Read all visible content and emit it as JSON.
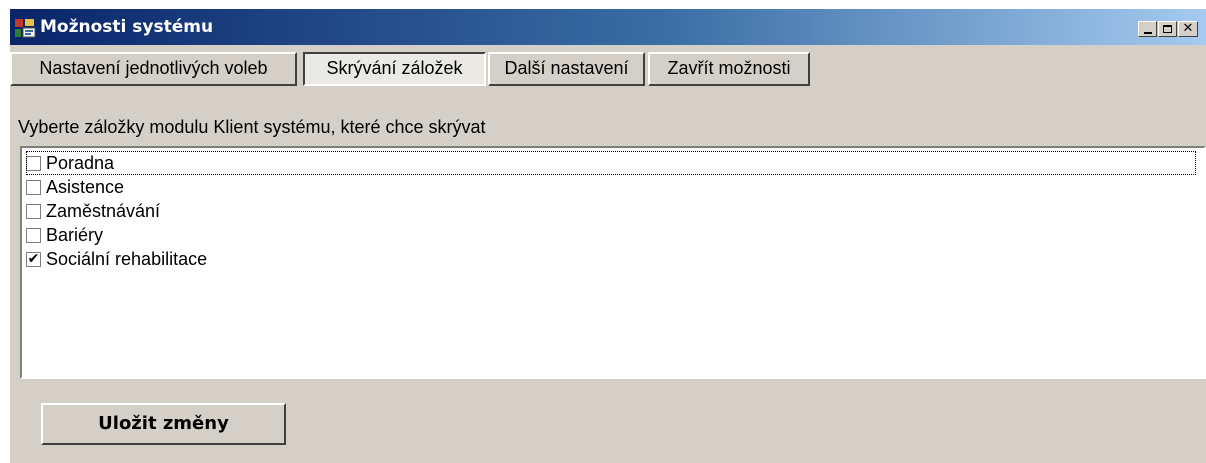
{
  "window": {
    "title": "Možnosti systému",
    "icon": "settings-app-icon",
    "controls": {
      "minimize_icon": "minimize-icon",
      "maximize_icon": "maximize-icon",
      "close_icon": "close-icon",
      "close_glyph": "✕"
    }
  },
  "toolbar": {
    "tabs": [
      {
        "label": "Nastavení jednotlivých voleb",
        "active": false
      },
      {
        "label": "Skrývání záložek",
        "active": true
      },
      {
        "label": "Další nastavení",
        "active": false
      },
      {
        "label": "Zavřít možnosti",
        "active": false
      }
    ]
  },
  "main": {
    "instruction": "Vyberte záložky modulu Klient systému, které chce skrývat",
    "items": [
      {
        "label": "Poradna",
        "checked": false,
        "focused": true
      },
      {
        "label": "Asistence",
        "checked": false,
        "focused": false
      },
      {
        "label": "Zaměstnávání",
        "checked": false,
        "focused": false
      },
      {
        "label": "Bariéry",
        "checked": false,
        "focused": false
      },
      {
        "label": "Sociální rehabilitace",
        "checked": true,
        "focused": false
      }
    ],
    "checkmark_glyph": "✔"
  },
  "actions": {
    "save_label": "Uložit změny"
  },
  "colors": {
    "titlebar_start": "#0a246a",
    "titlebar_end": "#a6caf0",
    "face": "#d4d0c8",
    "list_background": "#ffffff"
  }
}
